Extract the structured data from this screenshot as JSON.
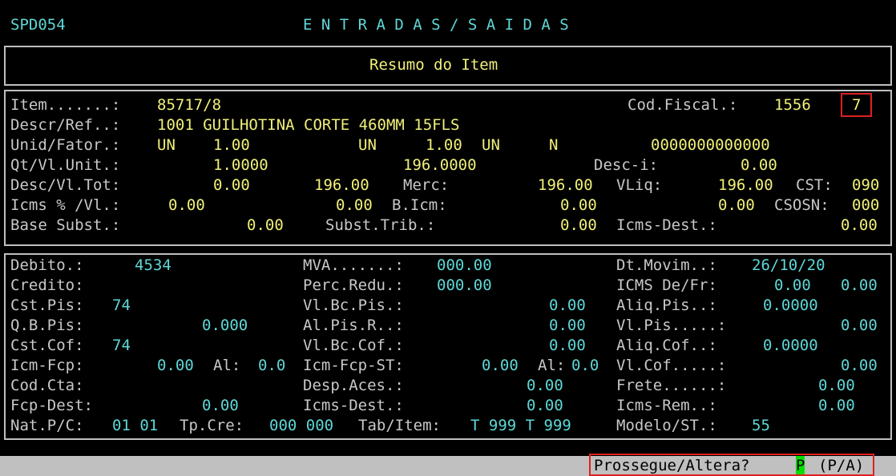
{
  "header": {
    "program": "SPD054",
    "title": "E N T R A D A S / S A I D A S"
  },
  "panel_title": "Resumo do Item",
  "item_section": {
    "item_label": "Item.......:",
    "item_value": "85717/8",
    "codfiscal_label": "Cod.Fiscal.:",
    "codfiscal_value": "1556",
    "codfiscal_extra": "7",
    "descr_label": "Descr/Ref..:",
    "descr_value": "1001 GUILHOTINA CORTE 460MM 15FLS",
    "unid_label": "Unid/Fator.:",
    "unid_1": "UN",
    "fator_1": "1.00",
    "unid_2": "UN",
    "fator_2": "1.00",
    "unid_3": "UN",
    "flag_n": "N",
    "code_zeros": "0000000000000",
    "qt_label": "Qt/Vl.Unit.:",
    "qt_value": "1.0000",
    "vlunit_value": "196.0000",
    "desci_label": "Desc-i:",
    "desci_value": "0.00",
    "desc_label": "Desc/Vl.Tot:",
    "desc_value": "0.00",
    "vltot_value": "196.00",
    "merc_label": "Merc:",
    "merc_value": "196.00",
    "vliq_label": "VLiq:",
    "vliq_value": "196.00",
    "cst_label": "CST:",
    "cst_value": "090",
    "icms_label": "Icms % /Vl.:",
    "icms_pct": "0.00",
    "icms_vl": "0.00",
    "bicm_label": "B.Icm:",
    "bicm_value": "0.00",
    "bicm_extra": "0.00",
    "csosn_label": "CSOSN:",
    "csosn_value": "000",
    "base_label": "Base Subst.:",
    "base_value": "0.00",
    "subst_label": "Subst.Trib.:",
    "subst_value": "0.00",
    "icmsdest_label": "Icms-Dest.:",
    "icmsdest_value": "0.00"
  },
  "fiscal_section": {
    "debito_label": "Debito.:",
    "debito_value": "4534",
    "mva_label": "MVA.......:",
    "mva_value": "000.00",
    "dtmovim_label": "Dt.Movim..:",
    "dtmovim_value": "26/10/20",
    "credito_label": "Credito:",
    "percredu_label": "Perc.Redu.:",
    "percredu_value": "000.00",
    "icmsdefr_label": "ICMS De/Fr:",
    "icmsdefr_value1": "0.00",
    "icmsdefr_value2": "0.00",
    "cstpis_label": "Cst.Pis:",
    "cstpis_value": "74",
    "vlbcpis_label": "Vl.Bc.Pis.:",
    "vlbcpis_value": "0.00",
    "aliqpis_label": "Aliq.Pis..:",
    "aliqpis_value": "0.0000",
    "qbpis_label": "Q.B.Pis:",
    "qbpis_value": "0.000",
    "alpisr_label": "Al.Pis.R..:",
    "alpisr_value": "0.00",
    "vlpis_label": "Vl.Pis.....:",
    "vlpis_value": "0.00",
    "cstcof_label": "Cst.Cof:",
    "cstcof_value": "74",
    "vlbccof_label": "Vl.Bc.Cof.:",
    "vlbccof_value": "0.00",
    "aliqcof_label": "Aliq.Cof..:",
    "aliqcof_value": "0.0000",
    "icmfcp_label": "Icm-Fcp:",
    "icmfcp_value": "0.00",
    "al1_label": "Al:",
    "al1_value": "0.0",
    "icmfcpst_label": "Icm-Fcp-ST:",
    "icmfcpst_value": "0.00",
    "al2_label": "Al:",
    "al2_value": "0.0",
    "vlcof_label": "Vl.Cof.....:",
    "vlcof_value": "0.00",
    "codcta_label": "Cod.Cta:",
    "despaces_label": "Desp.Aces.:",
    "despaces_value": "0.00",
    "frete_label": "Frete......:",
    "frete_value": "0.00",
    "fcpdest_label": "Fcp-Dest:",
    "fcpdest_value": "0.00",
    "icmsdest2_label": "Icms-Dest.:",
    "icmsdest2_value": "0.00",
    "icmsrem_label": "Icms-Rem..:",
    "icmsrem_value": "0.00",
    "natpc_label": "Nat.P/C:",
    "natpc_value": "01 01",
    "tpcre_label": "Tp.Cre:",
    "tpcre_value": "000 000",
    "tabitem_label": "Tab/Item:",
    "tabitem_value": "T 999 T 999",
    "modelo_label": "Modelo/ST.:",
    "modelo_value": "55"
  },
  "prompt": {
    "question": "Prossegue/Altera?",
    "answer": "P",
    "options": "(P/A)"
  },
  "colors": {
    "label": "#c8c8c8",
    "yellow_value": "#f0f07a",
    "cyan_value": "#5fd7d7",
    "highlight": "#e02020",
    "cursor": "#00e000"
  }
}
